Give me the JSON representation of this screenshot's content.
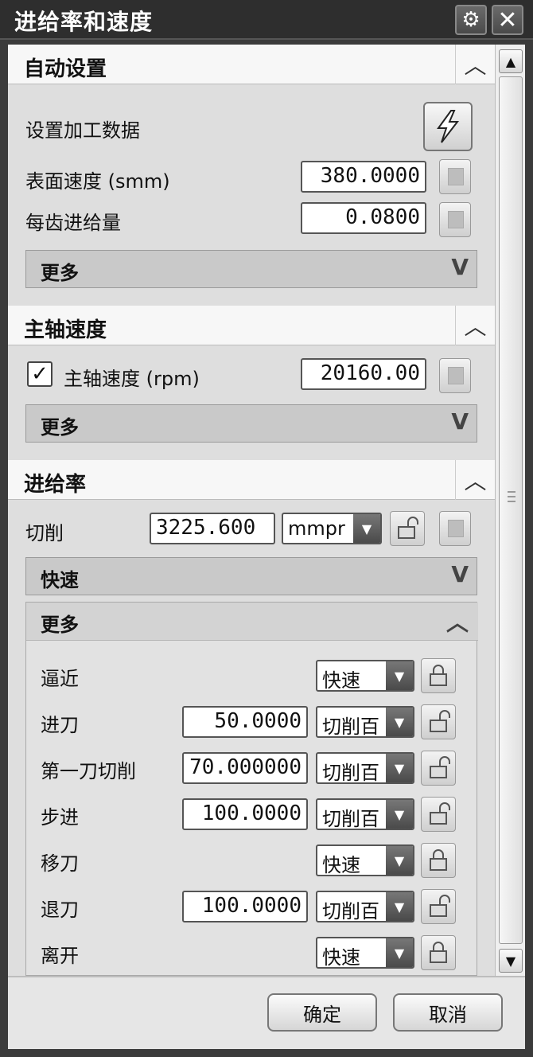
{
  "window": {
    "title": "进给率和速度"
  },
  "auto_settings": {
    "header": "自动设置",
    "set_data_label": "设置加工数据",
    "surface_speed_label": "表面速度 (smm)",
    "surface_speed_value": "380.0000",
    "feed_per_tooth_label": "每齿进给量",
    "feed_per_tooth_value": "0.0800",
    "more_label": "更多"
  },
  "spindle": {
    "header": "主轴速度",
    "checkbox_checked": true,
    "speed_label": "主轴速度 (rpm)",
    "speed_value": "20160.00",
    "more_label": "更多"
  },
  "feed": {
    "header": "进给率",
    "cut_label": "切削",
    "cut_value": "3225.600",
    "cut_unit": "mmpr",
    "rapid_label": "快速",
    "more_label": "更多",
    "rows": [
      {
        "label": "逼近",
        "value": "",
        "mode": "快速",
        "locked": true
      },
      {
        "label": "进刀",
        "value": "50.0000",
        "mode": "切削百",
        "locked": false
      },
      {
        "label": "第一刀切削",
        "value": "70.000000",
        "mode": "切削百",
        "locked": false
      },
      {
        "label": "步进",
        "value": "100.0000",
        "mode": "切削百",
        "locked": false
      },
      {
        "label": "移刀",
        "value": "",
        "mode": "快速",
        "locked": true
      },
      {
        "label": "退刀",
        "value": "100.0000",
        "mode": "切削百",
        "locked": false
      },
      {
        "label": "离开",
        "value": "",
        "mode": "快速",
        "locked": true
      }
    ]
  },
  "footer": {
    "ok_label": "确定",
    "cancel_label": "取消"
  }
}
